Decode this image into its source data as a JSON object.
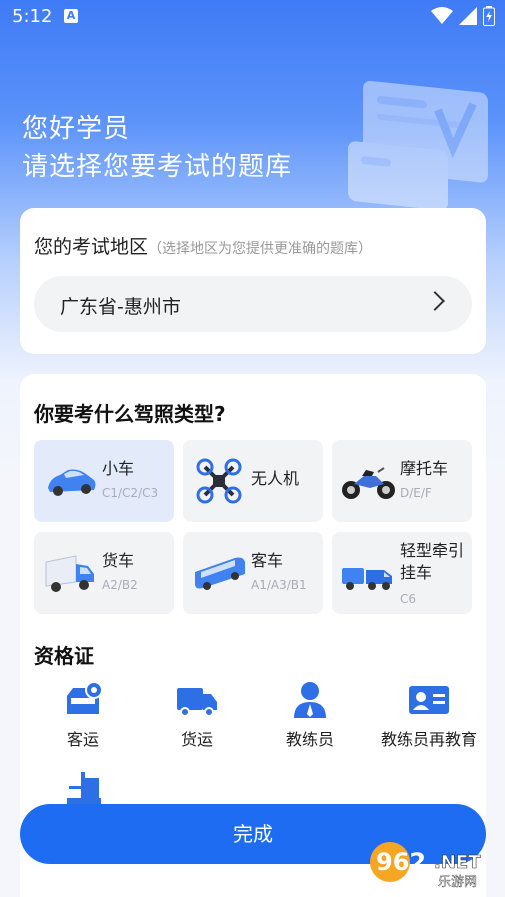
{
  "status_bar": {
    "time": "5:12",
    "notif": "A"
  },
  "header": {
    "line1": "您好学员",
    "line2": "请选择您要考试的题库"
  },
  "region": {
    "title": "您的考试地区",
    "hint": "（选择地区为您提供更准确的题库）",
    "value": "广东省-惠州市"
  },
  "license": {
    "title": "你要考什么驾照类型?",
    "tiles": [
      {
        "name": "小车",
        "code": "C1/C2/C3",
        "icon": "car-icon",
        "selected": true
      },
      {
        "name": "无人机",
        "code": "",
        "icon": "drone-icon",
        "selected": false
      },
      {
        "name": "摩托车",
        "code": "D/E/F",
        "icon": "motorcycle-icon",
        "selected": false
      },
      {
        "name": "货车",
        "code": "A2/B2",
        "icon": "truck-icon",
        "selected": false
      },
      {
        "name": "客车",
        "code": "A1/A3/B1",
        "icon": "bus-icon",
        "selected": false
      },
      {
        "name": "轻型牵引挂车",
        "code": "C6",
        "icon": "trailer-icon",
        "selected": false
      }
    ]
  },
  "qualification": {
    "title": "资格证",
    "items": [
      {
        "label": "客运",
        "icon": "passenger-transport-icon"
      },
      {
        "label": "货运",
        "icon": "freight-icon"
      },
      {
        "label": "教练员",
        "icon": "coach-icon"
      },
      {
        "label": "教练员再教育",
        "icon": "coach-id-card-icon"
      },
      {
        "label": "",
        "icon": "forklift-icon"
      }
    ]
  },
  "actions": {
    "done": "完成"
  },
  "watermark": {
    "brand": "962",
    "suffix": ".NET",
    "sub": "乐游网"
  },
  "colors": {
    "accent": "#1e6cf2",
    "selected_tile": "#e3ebfb",
    "tile_bg": "#f2f3f5",
    "icon_blue": "#2f6fe6"
  }
}
